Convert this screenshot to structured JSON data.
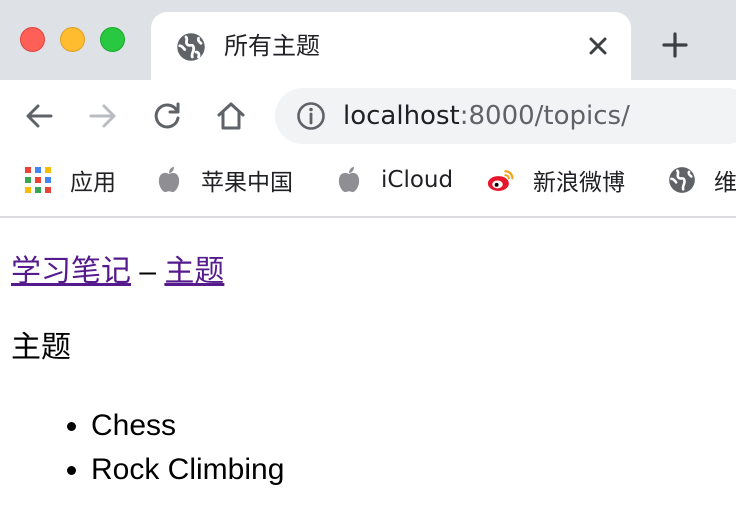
{
  "tab": {
    "title": "所有主题",
    "favicon": "globe-icon"
  },
  "address_bar": {
    "host": "localhost",
    "path": ":8000/topics/"
  },
  "bookmarks": [
    {
      "label": "应用",
      "icon": "apps-grid-icon"
    },
    {
      "label": "苹果中国",
      "icon": "apple-icon"
    },
    {
      "label": "iCloud",
      "icon": "apple-icon"
    },
    {
      "label": "新浪微博",
      "icon": "weibo-icon"
    },
    {
      "label": "维",
      "icon": "globe-icon"
    }
  ],
  "page": {
    "breadcrumb_home": "学习笔记",
    "breadcrumb_sep": "–",
    "breadcrumb_current": "主题",
    "heading": "主题",
    "topics": [
      "Chess",
      "Rock Climbing"
    ]
  },
  "colors": {
    "tabstrip_bg": "#dee1e6",
    "visited_link": "#551a8b",
    "omnibox_bg": "#f1f3f4"
  }
}
